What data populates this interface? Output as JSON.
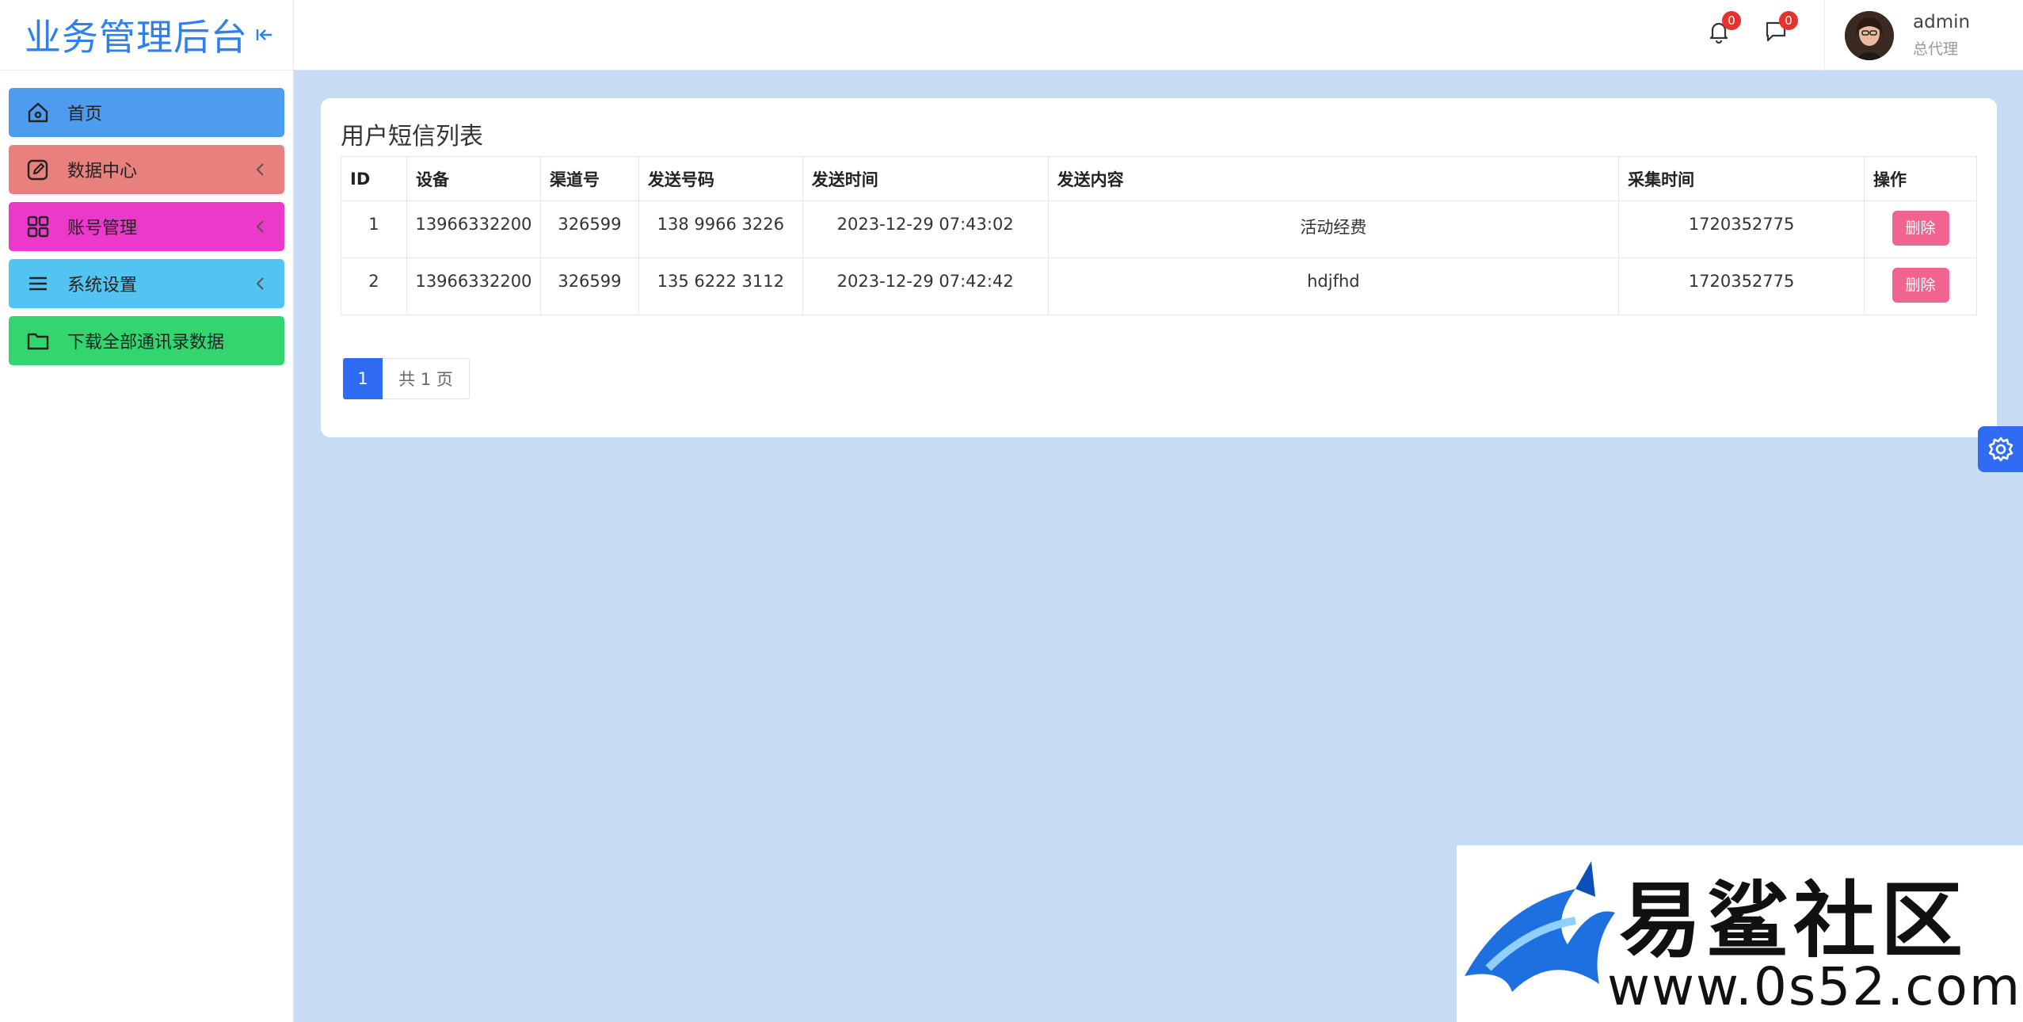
{
  "brand": {
    "title": "业务管理后台"
  },
  "sidebar": {
    "items": [
      {
        "label": "首页",
        "icon": "home-icon"
      },
      {
        "label": "数据中心",
        "icon": "edit-icon"
      },
      {
        "label": "账号管理",
        "icon": "grid-icon"
      },
      {
        "label": "系统设置",
        "icon": "menu-icon"
      },
      {
        "label": "下载全部通讯录数据",
        "icon": "folder-icon"
      }
    ]
  },
  "header": {
    "notifications_count": "0",
    "messages_count": "0",
    "user_name": "admin",
    "user_role": "总代理"
  },
  "main": {
    "title": "用户短信列表",
    "columns": [
      "ID",
      "设备",
      "渠道号",
      "发送号码",
      "发送时间",
      "发送内容",
      "采集时间",
      "操作"
    ],
    "rows": [
      {
        "id": "1",
        "device": "13966332200",
        "channel": "326599",
        "phone": "138 9966 3226",
        "send_time": "2023-12-29 07:43:02",
        "content": "活动经费",
        "collect_time": "1720352775",
        "action": "删除"
      },
      {
        "id": "2",
        "device": "13966332200",
        "channel": "326599",
        "phone": "135 6222 3112",
        "send_time": "2023-12-29 07:42:42",
        "content": "hdjfhd",
        "collect_time": "1720352775",
        "action": "删除"
      }
    ],
    "pagination": {
      "current": "1",
      "total_label": "共 1 页"
    }
  },
  "watermark": {
    "name": "易鲨社区",
    "url": "www.0s52.com"
  },
  "colors": {
    "accent": "#2f6cf3",
    "menu_home": "#4e9cf0",
    "menu_data": "#e8807e",
    "menu_account": "#ec39c9",
    "menu_settings": "#53c3f1",
    "menu_download": "#33d56e",
    "delete_button": "#f0648f",
    "badge": "#e5322d"
  }
}
